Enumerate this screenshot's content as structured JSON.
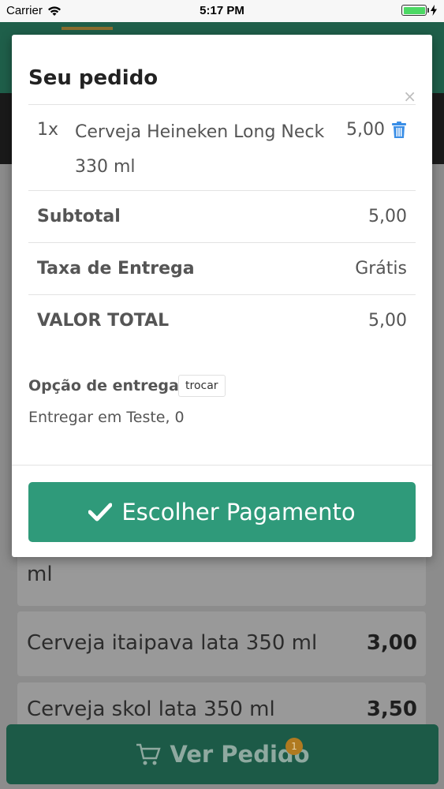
{
  "status_bar": {
    "carrier": "Carrier",
    "time": "5:17 PM"
  },
  "background": {
    "partial_item_text": "ml",
    "items": [
      {
        "name": "Cerveja itaipava lata 350 ml",
        "price": "3,00"
      },
      {
        "name": "Cerveja skol lata 350 ml",
        "price": "3,50"
      }
    ],
    "view_order_button": "Ver Pedido",
    "cart_badge": "1"
  },
  "modal": {
    "title": "Seu pedido",
    "close_symbol": "×",
    "item": {
      "qty": "1x",
      "name": "Cerveja Heineken Long Neck 330 ml",
      "price": "5,00"
    },
    "subtotal_label": "Subtotal",
    "subtotal_value": "5,00",
    "delivery_fee_label": "Taxa de Entrega",
    "delivery_fee_value": "Grátis",
    "total_label": "VALOR TOTAL",
    "total_value": "5,00",
    "delivery_option_label": "Opção de entrega",
    "swap_button": "trocar",
    "delivery_address": "Entregar em Teste, 0",
    "pay_button": "Escolher Pagamento"
  },
  "colors": {
    "primary": "#2f9a7a",
    "trash_icon": "#3a8ee6"
  }
}
